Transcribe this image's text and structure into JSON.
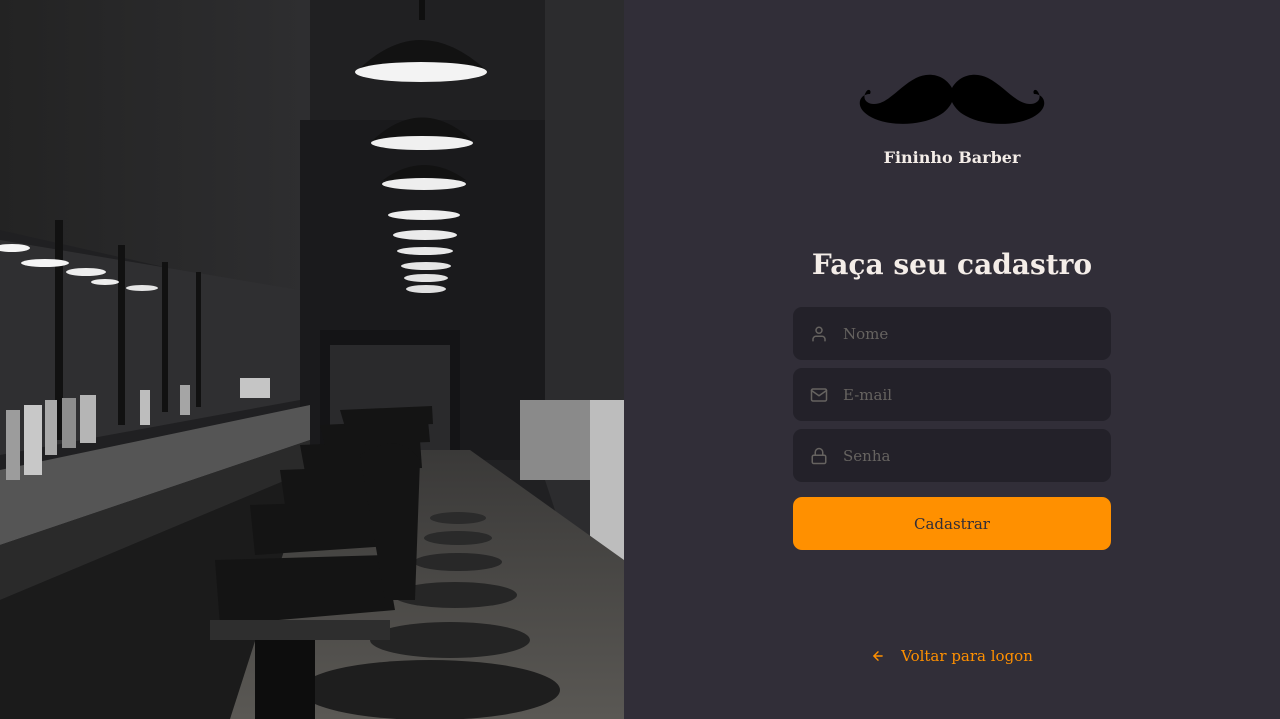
{
  "brand": {
    "logo_icon": "mustache-icon",
    "name": "Fininho Barber"
  },
  "form": {
    "title": "Faça seu cadastro",
    "fields": [
      {
        "icon": "user-icon",
        "placeholder": "Nome",
        "value": ""
      },
      {
        "icon": "mail-icon",
        "placeholder": "E-mail",
        "value": ""
      },
      {
        "icon": "lock-icon",
        "placeholder": "Senha",
        "value": ""
      }
    ],
    "submit_label": "Cadastrar"
  },
  "back_link": {
    "icon": "arrow-left-icon",
    "label": "Voltar para logon"
  },
  "colors": {
    "background": "#312e38",
    "input_background": "#232129",
    "accent": "#ff9000",
    "text": "#f4ede8",
    "placeholder": "#666360"
  },
  "background_image": {
    "subject": "barbershop-interior-photo"
  }
}
